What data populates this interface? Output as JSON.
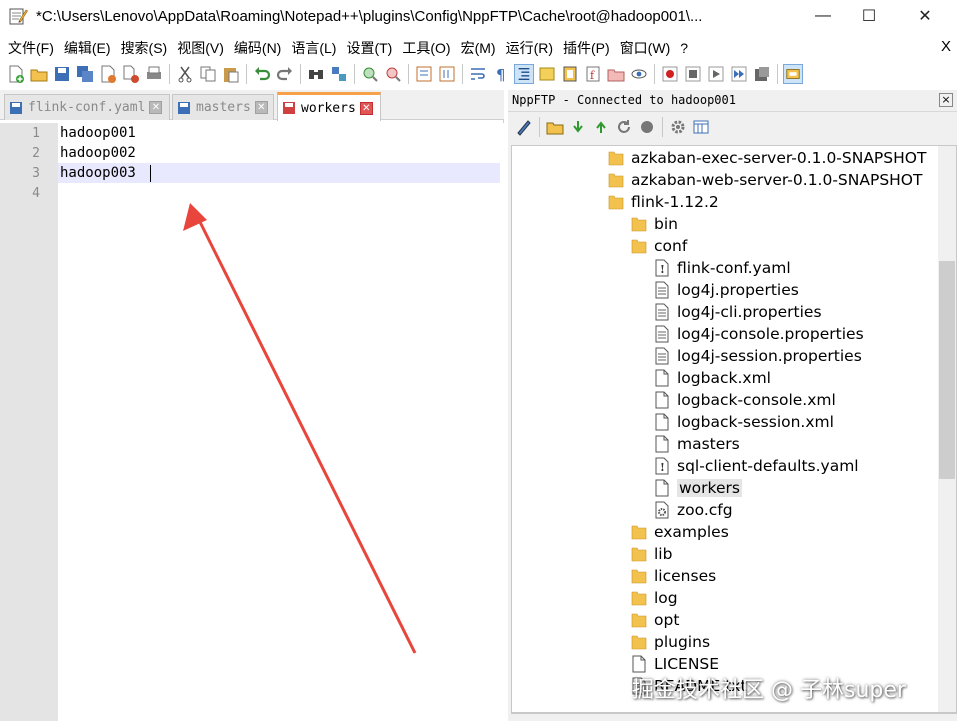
{
  "window": {
    "title": "*C:\\Users\\Lenovo\\AppData\\Roaming\\Notepad++\\plugins\\Config\\NppFTP\\Cache\\root@hadoop001\\...",
    "min_glyph": "—",
    "max_glyph": "☐",
    "close_glyph": "✕"
  },
  "menu": {
    "items": [
      "文件(F)",
      "编辑(E)",
      "搜索(S)",
      "视图(V)",
      "编码(N)",
      "语言(L)",
      "设置(T)",
      "工具(O)",
      "宏(M)",
      "运行(R)",
      "插件(P)",
      "窗口(W)",
      "?"
    ],
    "close_glyph": "X"
  },
  "tabs": [
    {
      "label": "flink-conf.yaml",
      "active": false
    },
    {
      "label": "masters",
      "active": false
    },
    {
      "label": "workers",
      "active": true
    }
  ],
  "editor": {
    "line_numbers": [
      "1",
      "2",
      "3",
      "4"
    ],
    "lines": [
      "hadoop001",
      "hadoop002",
      "hadoop003",
      ""
    ]
  },
  "ftp": {
    "header": "NppFTP - Connected to hadoop001",
    "close_glyph": "×",
    "tree": [
      {
        "label": "azkaban-exec-server-0.1.0-SNAPSHOT",
        "type": "folder",
        "depth": 0
      },
      {
        "label": "azkaban-web-server-0.1.0-SNAPSHOT",
        "type": "folder",
        "depth": 0
      },
      {
        "label": "flink-1.12.2",
        "type": "folder",
        "depth": 0
      },
      {
        "label": "bin",
        "type": "folder",
        "depth": 1
      },
      {
        "label": "conf",
        "type": "folder",
        "depth": 1
      },
      {
        "label": "flink-conf.yaml",
        "type": "file-warning",
        "depth": 2
      },
      {
        "label": "log4j.properties",
        "type": "file-text",
        "depth": 2
      },
      {
        "label": "log4j-cli.properties",
        "type": "file-text",
        "depth": 2
      },
      {
        "label": "log4j-console.properties",
        "type": "file-text",
        "depth": 2
      },
      {
        "label": "log4j-session.properties",
        "type": "file-text",
        "depth": 2
      },
      {
        "label": "logback.xml",
        "type": "file",
        "depth": 2
      },
      {
        "label": "logback-console.xml",
        "type": "file",
        "depth": 2
      },
      {
        "label": "logback-session.xml",
        "type": "file",
        "depth": 2
      },
      {
        "label": "masters",
        "type": "file",
        "depth": 2
      },
      {
        "label": "sql-client-defaults.yaml",
        "type": "file-warning",
        "depth": 2
      },
      {
        "label": "workers",
        "type": "file",
        "depth": 2,
        "selected": true
      },
      {
        "label": "zoo.cfg",
        "type": "file-gear",
        "depth": 2
      },
      {
        "label": "examples",
        "type": "folder",
        "depth": 1
      },
      {
        "label": "lib",
        "type": "folder",
        "depth": 1
      },
      {
        "label": "licenses",
        "type": "folder",
        "depth": 1
      },
      {
        "label": "log",
        "type": "folder",
        "depth": 1
      },
      {
        "label": "opt",
        "type": "folder",
        "depth": 1
      },
      {
        "label": "plugins",
        "type": "folder",
        "depth": 1
      },
      {
        "label": "LICENSE",
        "type": "file",
        "depth": 1
      },
      {
        "label": "README.txt",
        "type": "file-text",
        "depth": 1
      }
    ]
  },
  "watermark": "掘金技术社区 @ 子林super",
  "colors": {
    "active_tab_accent": "#f7a14a",
    "folder": "#f2c14e",
    "arrow": "#e8463c",
    "current_line": "#e8e8ff"
  }
}
